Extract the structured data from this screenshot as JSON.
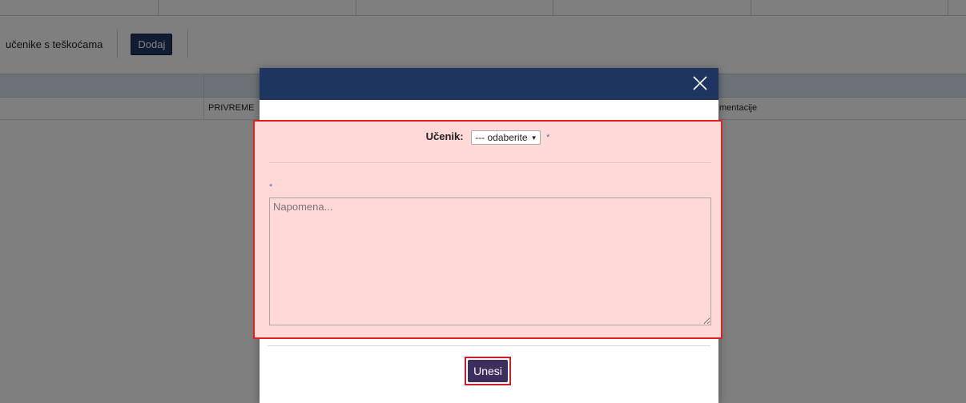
{
  "toolbar": {
    "label": "učenike s teškoćama",
    "add_button": "Dodaj"
  },
  "grid": {
    "row": {
      "status": "PRIVREME",
      "docs": "mentacije"
    }
  },
  "modal": {
    "close_icon": "close-icon",
    "student_label": "Učenik:",
    "student_select_value": "--- odaberite",
    "required_mark": "*",
    "note_placeholder": "Napomena...",
    "submit_button": "Unesi"
  },
  "colors": {
    "header": "#1e3560",
    "add_button": "#1f3864",
    "submit_button": "#3c2f5e",
    "highlight_border": "#e02020",
    "highlight_fill": "#ffd8d8"
  }
}
